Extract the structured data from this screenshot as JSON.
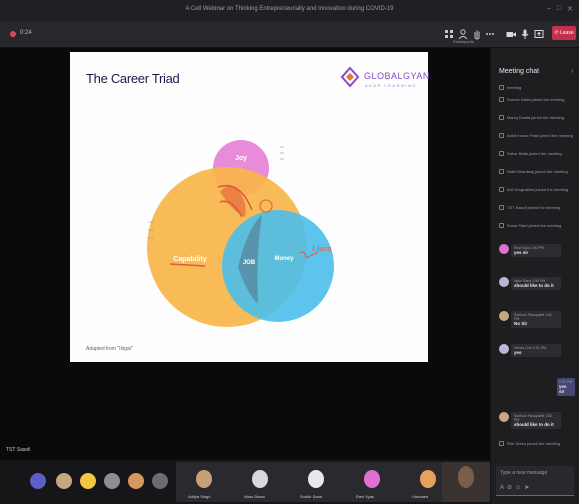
{
  "window": {
    "title": "A Cell Webinar on Thinking Entrepreneurially and Innovation during COVID-19",
    "controls": [
      "–",
      "□",
      "✕"
    ]
  },
  "toolbar": {
    "timer": "0:24",
    "items": [
      {
        "icon": "grid-view-icon",
        "label": ""
      },
      {
        "icon": "participants-icon",
        "label": "Participants"
      },
      {
        "icon": "raise-hand-icon",
        "label": ""
      },
      {
        "icon": "more-options-icon",
        "label": ""
      },
      {
        "icon": "camera-icon",
        "label": ""
      },
      {
        "icon": "microphone-icon",
        "label": ""
      },
      {
        "icon": "share-screen-icon",
        "label": ""
      }
    ],
    "leave_label": "Leave"
  },
  "slide": {
    "title": "The Career Triad",
    "logo_main": "GLOBALGYAN",
    "logo_sub": "AKAR LEARNING",
    "circles": {
      "joy": "Joy",
      "capability": "Capability",
      "money": "Money",
      "center": "JOB"
    },
    "annotation": "Listen",
    "footer": "Adapted from \"Ikigai\"",
    "colors": {
      "joy": "#e88bd9",
      "capability": "#f9b54a",
      "money": "#4bbfeb",
      "ink": "#e05a3a"
    }
  },
  "stage": {
    "presenter_name": "TST Sasoli"
  },
  "strip": {
    "participants": [
      {
        "name": "Aditya Singh",
        "avatar_color": "#c7a07a"
      },
      {
        "name": "Nirav Desai",
        "avatar_color": "#d8d8de"
      },
      {
        "name": "Sudhir Sane",
        "avatar_color": "#e8e8ee"
      },
      {
        "name": "Ravi Vyas",
        "avatar_color": "#e06fd2"
      },
      {
        "name": "Unmuted",
        "avatar_color": "#e6a060"
      }
    ]
  },
  "chat": {
    "title": "Meeting chat",
    "system_messages": [
      "meeting",
      "Suresh Gada joined the meeting",
      "Manoj Dwala joined the meeting",
      "Ankit Kumar Patel joined the meeting",
      "Sahar Batia joined the meeting",
      "Nidhi Bhardwaj joined the meeting",
      "Arif Zengrabhia joined the meeting",
      "TST Sasoli joined the meeting",
      "Sonal Patel joined the meeting"
    ],
    "messages": [
      {
        "author": "Ravi Vyas",
        "time": "1:50 PM",
        "text": "yes sir"
      },
      {
        "author": "Nidhi Rana",
        "time": "1:50 PM",
        "text": "should like to do it"
      },
      {
        "author": "Santosh Pasupuleti",
        "time": "1:51 PM",
        "text": "No Sir"
      },
      {
        "author": "Vrinda Chvi",
        "time": "1:51 PM",
        "text": "yes"
      },
      {
        "author": "Santosh Pasupuleti",
        "time": "1:52 PM",
        "text": "should like to do it"
      }
    ],
    "own_message": {
      "time": "1:52 PM",
      "text": "yes sir"
    },
    "late_join": "Rhe Sreen joined the meeting",
    "compose_placeholder": "Type a new message"
  }
}
